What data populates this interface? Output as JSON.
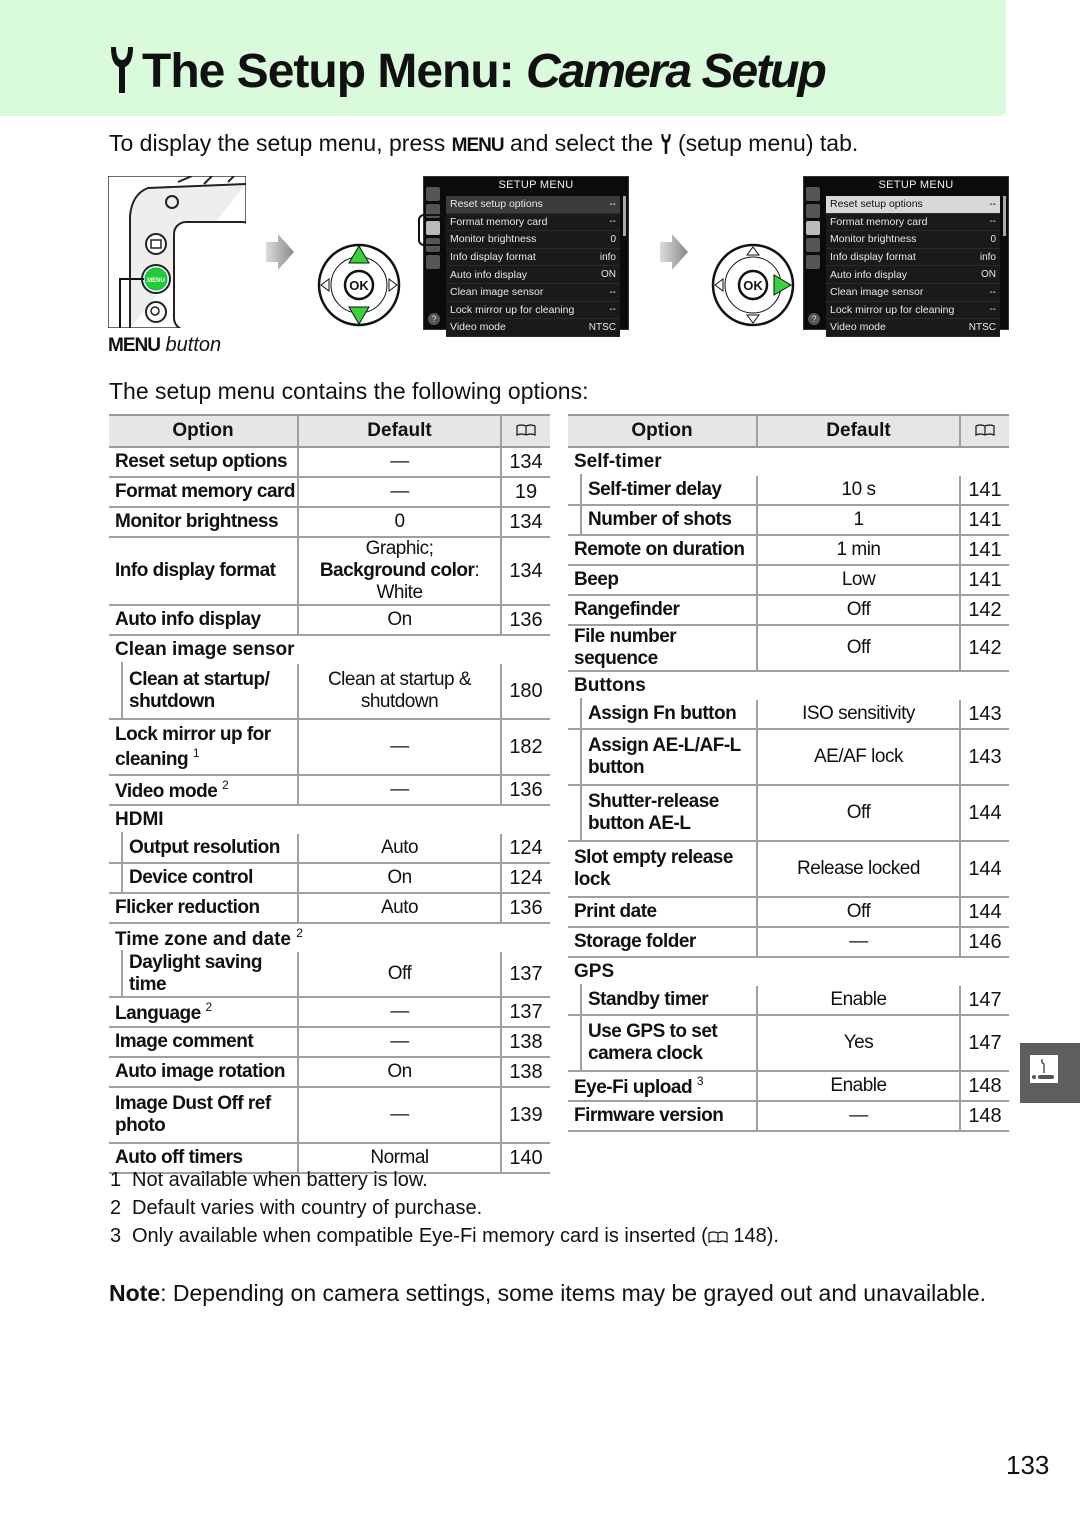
{
  "header": {
    "title_main": "The Setup Menu:",
    "title_italic": "Camera Setup",
    "wrench_icon": "wrench-icon",
    "accent_bg": "#d9fbdc"
  },
  "intro": {
    "before_menu": "To display the setup menu, press ",
    "menu_glyph": "MENU",
    "after_menu": " and select the ",
    "after_icon": " (setup menu) tab."
  },
  "illustration": {
    "menu_button_label_glyph": "MENU",
    "menu_button_label_text": " button",
    "screen_title": "SETUP MENU",
    "menu_rows": [
      {
        "label": "Reset setup options",
        "value": "--"
      },
      {
        "label": "Format memory card",
        "value": "--"
      },
      {
        "label": "Monitor brightness",
        "value": "0"
      },
      {
        "label": "Info display format",
        "value": "info"
      },
      {
        "label": "Auto info display",
        "value": "ON"
      },
      {
        "label": "Clean image sensor",
        "value": "--"
      },
      {
        "label": "Lock mirror up for cleaning",
        "value": "--"
      },
      {
        "label": "Video mode",
        "value": "NTSC"
      }
    ],
    "ok_label": "OK",
    "menu_key_label": "MENU",
    "help_glyph": "?"
  },
  "subhead": "The setup menu contains the following options:",
  "table_headers": {
    "option": "Option",
    "default": "Default",
    "page": "page-ref-icon"
  },
  "left_table": [
    {
      "type": "row",
      "option": "Reset setup options",
      "default": "—",
      "page": "134"
    },
    {
      "type": "row",
      "option": "Format memory card",
      "default": "—",
      "page": "19"
    },
    {
      "type": "row",
      "option": "Monitor brightness",
      "default": "0",
      "page": "134"
    },
    {
      "type": "row",
      "option": "Info display format",
      "default_line1": "Graphic;",
      "default_bold": "Background color",
      "default_rest": ": White",
      "page": "134"
    },
    {
      "type": "row",
      "option": "Auto info display",
      "default": "On",
      "page": "136"
    },
    {
      "type": "group",
      "option": "Clean image sensor"
    },
    {
      "type": "sub",
      "option": "Clean at startup/ shutdown",
      "default": "Clean at startup & shutdown",
      "page": "180"
    },
    {
      "type": "row",
      "option": "Lock mirror up for cleaning",
      "note": "1",
      "default": "—",
      "page": "182"
    },
    {
      "type": "row",
      "option": "Video mode",
      "note": "2",
      "default": "—",
      "page": "136"
    },
    {
      "type": "group",
      "option": "HDMI"
    },
    {
      "type": "sub",
      "option": "Output resolution",
      "default": "Auto",
      "page": "124"
    },
    {
      "type": "sub",
      "option": "Device control",
      "default": "On",
      "page": "124"
    },
    {
      "type": "row",
      "option": "Flicker reduction",
      "default": "Auto",
      "page": "136"
    },
    {
      "type": "group",
      "option": "Time zone and date",
      "note": "2"
    },
    {
      "type": "sub",
      "option": "Daylight saving time",
      "default": "Off",
      "page": "137"
    },
    {
      "type": "row",
      "option": "Language",
      "note": "2",
      "default": "—",
      "page": "137"
    },
    {
      "type": "row",
      "option": "Image comment",
      "default": "—",
      "page": "138"
    },
    {
      "type": "row",
      "option": "Auto image rotation",
      "default": "On",
      "page": "138"
    },
    {
      "type": "row",
      "option": "Image Dust Off ref photo",
      "default": "—",
      "page": "139"
    },
    {
      "type": "row",
      "option": "Auto off timers",
      "default": "Normal",
      "page": "140"
    }
  ],
  "right_table": [
    {
      "type": "group",
      "option": "Self-timer"
    },
    {
      "type": "sub",
      "option": "Self-timer delay",
      "default": "10 s",
      "page": "141"
    },
    {
      "type": "sub",
      "option": "Number of shots",
      "default": "1",
      "page": "141"
    },
    {
      "type": "row",
      "option": "Remote on duration",
      "default": "1 min",
      "page": "141"
    },
    {
      "type": "row",
      "option": "Beep",
      "default": "Low",
      "page": "141"
    },
    {
      "type": "row",
      "option": "Rangefinder",
      "default": "Off",
      "page": "142"
    },
    {
      "type": "row",
      "option": "File number sequence",
      "default": "Off",
      "page": "142"
    },
    {
      "type": "group",
      "option": "Buttons"
    },
    {
      "type": "sub",
      "option": "Assign Fn button",
      "default": "ISO sensitivity",
      "page": "143"
    },
    {
      "type": "sub",
      "option": "Assign AE-L/AF-L button",
      "default": "AE/AF lock",
      "page": "143"
    },
    {
      "type": "sub",
      "option": "Shutter-release button AE-L",
      "default": "Off",
      "page": "144"
    },
    {
      "type": "row",
      "option": "Slot empty release lock",
      "default": "Release locked",
      "page": "144"
    },
    {
      "type": "row",
      "option": "Print date",
      "default": "Off",
      "page": "144"
    },
    {
      "type": "row",
      "option": "Storage folder",
      "default": "—",
      "page": "146"
    },
    {
      "type": "group",
      "option": "GPS"
    },
    {
      "type": "sub",
      "option": "Standby timer",
      "default": "Enable",
      "page": "147"
    },
    {
      "type": "sub",
      "option": "Use GPS to set camera clock",
      "default": "Yes",
      "page": "147"
    },
    {
      "type": "row",
      "option": "Eye-Fi upload",
      "note": "3",
      "default": "Enable",
      "page": "148"
    },
    {
      "type": "row",
      "option": "Firmware version",
      "default": "—",
      "page": "148"
    }
  ],
  "footnotes": [
    {
      "num": "1",
      "text": "Not available when battery is low."
    },
    {
      "num": "2",
      "text": "Default varies with country of purchase."
    },
    {
      "num": "3",
      "text_before": "Only available when compatible Eye-Fi memory card is inserted (",
      "ref": " 148",
      "text_after": ")."
    }
  ],
  "note": {
    "label": "Note",
    "text": ": Depending on camera settings, some items may be grayed out and unavailable."
  },
  "side_tab_icon": "setup-menu-tab-icon",
  "page_number": "133"
}
